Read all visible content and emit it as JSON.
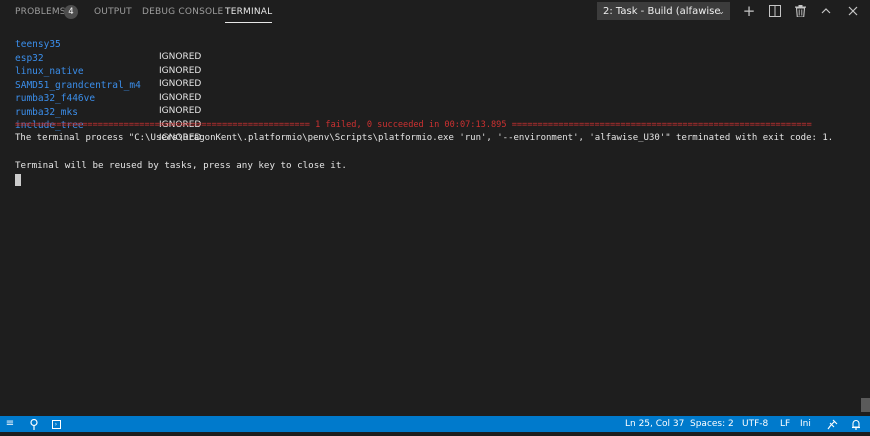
{
  "panel": {
    "tabs": [
      {
        "label": "PROBLEMS",
        "badge": "4"
      },
      {
        "label": "OUTPUT"
      },
      {
        "label": "DEBUG CONSOLE"
      },
      {
        "label": "TERMINAL"
      }
    ],
    "terminal_select": "2: Task - Build (alfawise",
    "icons": [
      "plus-icon",
      "split-icon",
      "trash-icon",
      "chevron-up-icon",
      "close-icon"
    ]
  },
  "terminal": {
    "environments": [
      {
        "name": "teensy35",
        "status": "IGNORED"
      },
      {
        "name": "esp32",
        "status": "IGNORED"
      },
      {
        "name": "linux_native",
        "status": "IGNORED"
      },
      {
        "name": "SAMD51_grandcentral_m4",
        "status": "IGNORED"
      },
      {
        "name": "rumba32_f446ve",
        "status": "IGNORED"
      },
      {
        "name": "rumba32_mks",
        "status": "IGNORED"
      },
      {
        "name": "include_tree",
        "status": "IGNORED"
      }
    ],
    "summary_line": "========================================================= 1 failed, 0 succeeded in 00:07:13.895 ==========================================================",
    "process_line": "The terminal process \"C:\\Users\\DragonKent\\.platformio\\penv\\Scripts\\platformio.exe 'run', '--environment', 'alfawise_U30'\" terminated with exit code: 1.",
    "reuse_line": "Terminal will be reused by tasks, press any key to close it."
  },
  "status_bar": {
    "position": "Ln 25, Col 37",
    "spaces": "Spaces: 2",
    "encoding": "UTF-8",
    "eol": "LF",
    "language": "Ini"
  },
  "colors": {
    "status_bar": "#007acc",
    "env_name": "#3b8eea",
    "error": "#cd3131",
    "background": "#1e1e1e"
  }
}
